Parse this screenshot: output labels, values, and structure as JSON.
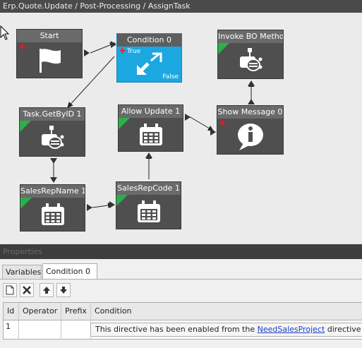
{
  "breadcrumb": "Erp.Quote.Update / Post-Processing / AssignTask",
  "nodes": {
    "start": {
      "title": "Start"
    },
    "condition": {
      "title": "Condition 0",
      "true_label": "True",
      "false_label": "False"
    },
    "invoke": {
      "title": "Invoke BO Method"
    },
    "getbyid": {
      "title": "Task.GetByID 1"
    },
    "allow": {
      "title": "Allow Update 1"
    },
    "showmsg": {
      "title": "Show Message 0"
    },
    "salesrepname": {
      "title": "SalesRepName 1"
    },
    "salesrepcode": {
      "title": "SalesRepCode 1"
    }
  },
  "properties": {
    "header": "Properties",
    "tabs": [
      {
        "label": "Variables",
        "active": false
      },
      {
        "label": "Condition 0",
        "active": true
      }
    ],
    "toolbar": {
      "new_icon": "new-document-icon",
      "delete_icon": "delete-x-icon",
      "up_icon": "arrow-up-icon",
      "down_icon": "arrow-down-icon"
    },
    "grid": {
      "columns": [
        "Id",
        "Operator",
        "Prefix",
        "Condition"
      ],
      "rows": [
        {
          "id": "1",
          "operator": "",
          "prefix": "",
          "condition_before": "This directive has been enabled from the ",
          "condition_link": "NeedSalesProject",
          "condition_after": " directive"
        }
      ]
    }
  },
  "colors": {
    "selected_node": "#1ba8e0",
    "green_marker": "#2bb04a",
    "red_marker": "#e02020"
  }
}
